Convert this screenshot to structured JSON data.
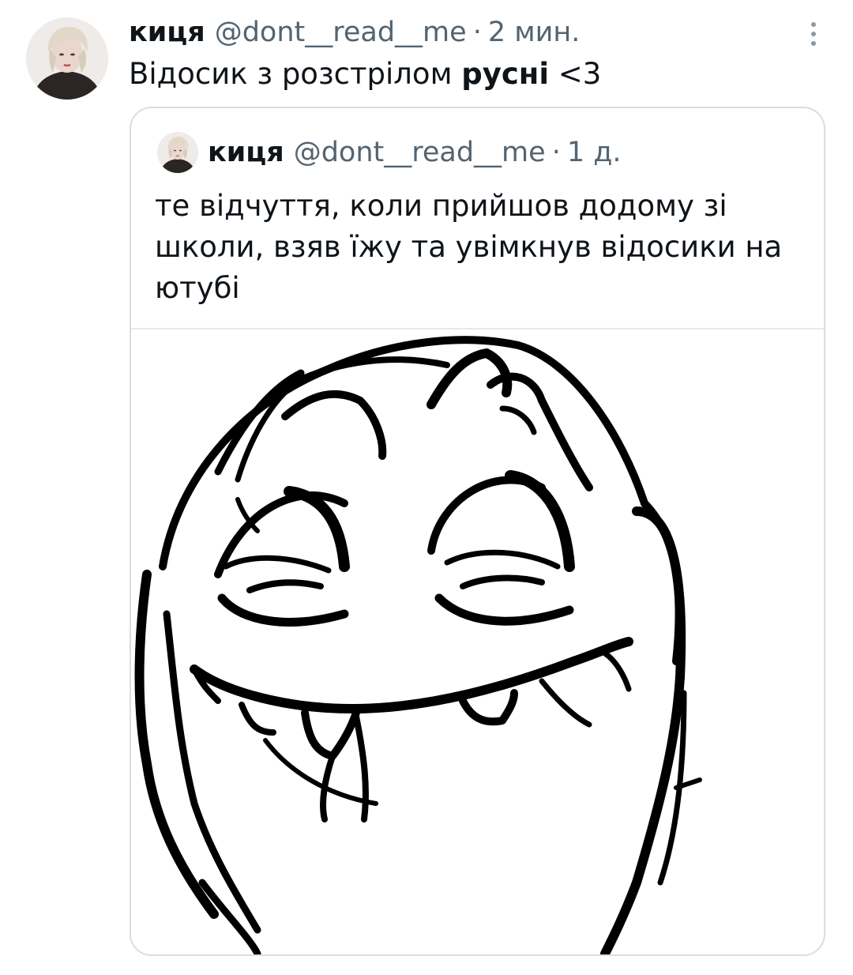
{
  "tweet": {
    "author": {
      "name": "киця",
      "handle": "@dont__read__me",
      "avatar": "profile-photo"
    },
    "separator": "·",
    "time": "2 мин.",
    "more_icon": "more-vertical-icon",
    "text_before": "Відосик з розстрілом ",
    "text_bold": "русні",
    "text_after": " <3",
    "quote": {
      "author": {
        "name": "киця",
        "handle": "@dont__read__me",
        "avatar": "profile-photo"
      },
      "separator": "·",
      "time": "1 д.",
      "text": "те відчуття, коли прийшов додому зі школи, взяв їжу та увімкнув відосики на ютубі",
      "media": "rage-comic-face-image"
    }
  },
  "colors": {
    "text": "#0f1419",
    "secondary": "#536471",
    "border": "#d9dde1",
    "background": "#ffffff"
  }
}
